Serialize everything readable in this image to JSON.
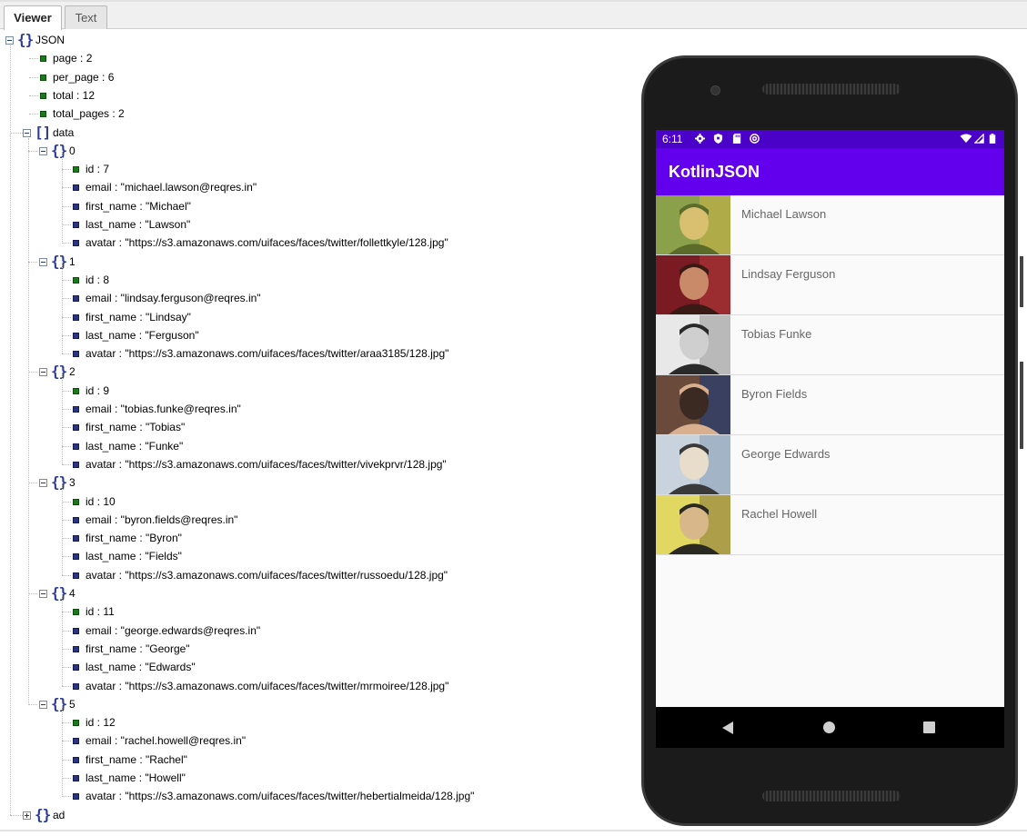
{
  "tabs": {
    "viewer": "Viewer",
    "text": "Text"
  },
  "tree": {
    "root": "JSON",
    "page": "page : 2",
    "per_page": "per_page : 6",
    "total": "total : 12",
    "total_pages": "total_pages : 2",
    "data": "data",
    "ad": "ad",
    "items": [
      {
        "index": "0",
        "id": "id : 7",
        "email": "email : \"michael.lawson@reqres.in\"",
        "first_name": "first_name : \"Michael\"",
        "last_name": "last_name : \"Lawson\"",
        "avatar": "avatar : \"https://s3.amazonaws.com/uifaces/faces/twitter/follettkyle/128.jpg\""
      },
      {
        "index": "1",
        "id": "id : 8",
        "email": "email : \"lindsay.ferguson@reqres.in\"",
        "first_name": "first_name : \"Lindsay\"",
        "last_name": "last_name : \"Ferguson\"",
        "avatar": "avatar : \"https://s3.amazonaws.com/uifaces/faces/twitter/araa3185/128.jpg\""
      },
      {
        "index": "2",
        "id": "id : 9",
        "email": "email : \"tobias.funke@reqres.in\"",
        "first_name": "first_name : \"Tobias\"",
        "last_name": "last_name : \"Funke\"",
        "avatar": "avatar : \"https://s3.amazonaws.com/uifaces/faces/twitter/vivekprvr/128.jpg\""
      },
      {
        "index": "3",
        "id": "id : 10",
        "email": "email : \"byron.fields@reqres.in\"",
        "first_name": "first_name : \"Byron\"",
        "last_name": "last_name : \"Fields\"",
        "avatar": "avatar : \"https://s3.amazonaws.com/uifaces/faces/twitter/russoedu/128.jpg\""
      },
      {
        "index": "4",
        "id": "id : 11",
        "email": "email : \"george.edwards@reqres.in\"",
        "first_name": "first_name : \"George\"",
        "last_name": "last_name : \"Edwards\"",
        "avatar": "avatar : \"https://s3.amazonaws.com/uifaces/faces/twitter/mrmoiree/128.jpg\""
      },
      {
        "index": "5",
        "id": "id : 12",
        "email": "email : \"rachel.howell@reqres.in\"",
        "first_name": "first_name : \"Rachel\"",
        "last_name": "last_name : \"Howell\"",
        "avatar": "avatar : \"https://s3.amazonaws.com/uifaces/faces/twitter/hebertialmeida/128.jpg\""
      }
    ]
  },
  "phone": {
    "status_time": "6:11",
    "status_left_icons": [
      "gear-icon",
      "shield-icon",
      "sd-card-icon",
      "at-icon"
    ],
    "status_right_icons": [
      "wifi-icon",
      "signal-icon",
      "battery-icon"
    ],
    "app_title": "KotlinJSON",
    "app_bar_color": "#6200ee",
    "status_bar_color": "#4a02c8",
    "users": [
      {
        "name": "Michael Lawson",
        "avatar_icon": "avatar-photo"
      },
      {
        "name": "Lindsay Ferguson",
        "avatar_icon": "avatar-photo"
      },
      {
        "name": "Tobias Funke",
        "avatar_icon": "avatar-photo"
      },
      {
        "name": "Byron Fields",
        "avatar_icon": "avatar-photo"
      },
      {
        "name": "George Edwards",
        "avatar_icon": "avatar-photo"
      },
      {
        "name": "Rachel Howell",
        "avatar_icon": "avatar-photo"
      }
    ],
    "nav_icons": [
      "back-icon",
      "home-icon",
      "recents-icon"
    ]
  }
}
